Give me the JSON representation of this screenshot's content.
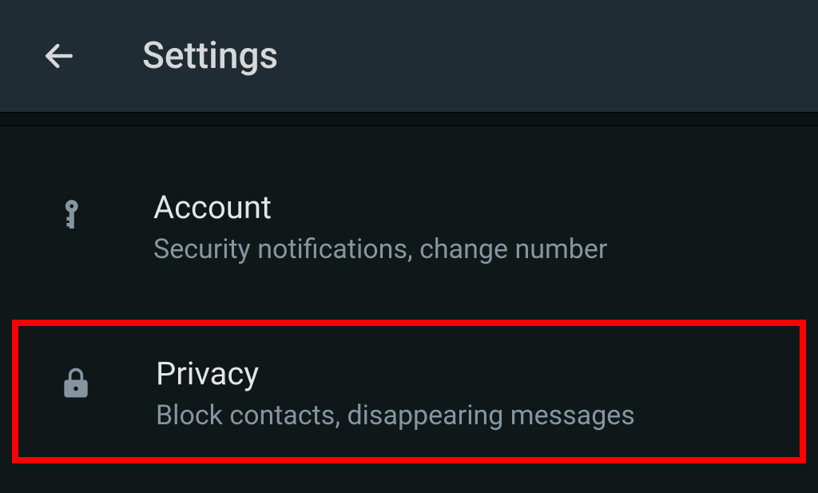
{
  "header": {
    "title": "Settings"
  },
  "items": [
    {
      "title": "Account",
      "description": "Security notifications, change number"
    },
    {
      "title": "Privacy",
      "description": "Block contacts, disappearing messages"
    }
  ]
}
